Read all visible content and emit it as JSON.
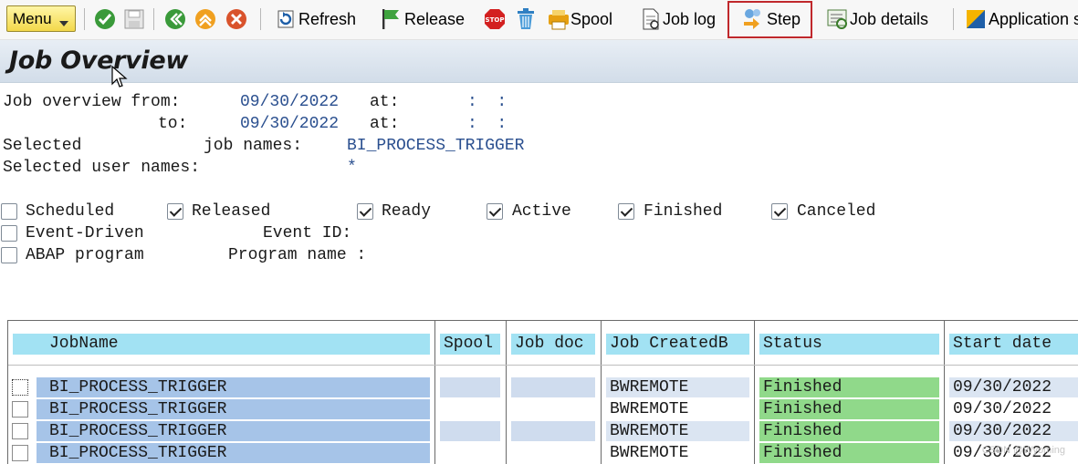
{
  "toolbar": {
    "menu_label": "Menu",
    "refresh_label": "Refresh",
    "release_label": "Release",
    "spool_label": "Spool",
    "job_log_label": "Job log",
    "step_label": "Step",
    "job_details_label": "Job details",
    "application_label": "Application s",
    "stop_icon_text": "STOP"
  },
  "title": "Job Overview",
  "criteria": {
    "from_label": "Job overview from:",
    "from_date": "09/30/2022",
    "to_label": "to:",
    "to_date": "09/30/2022",
    "at_label": "at:",
    "from_time": ":  :",
    "to_time": ":  :",
    "selected_label": "Selected",
    "job_names_label": "job names:",
    "job_names_value": "BI_PROCESS_TRIGGER",
    "user_names_label": "Selected user names:",
    "user_names_value": "*",
    "status_filters": [
      {
        "label": "Scheduled",
        "checked": false
      },
      {
        "label": "Released",
        "checked": true
      },
      {
        "label": "Ready",
        "checked": true
      },
      {
        "label": "Active",
        "checked": true
      },
      {
        "label": "Finished",
        "checked": true
      },
      {
        "label": "Canceled",
        "checked": true
      }
    ],
    "event_driven_label": "Event-Driven",
    "event_id_label": "Event ID:",
    "abap_program_label": "ABAP program",
    "program_name_label": "Program name :"
  },
  "table": {
    "columns": [
      "JobName",
      "Spool",
      "Job doc",
      "Job CreatedB",
      "Status",
      "Start date"
    ],
    "rows": [
      {
        "job_name": "BI_PROCESS_TRIGGER",
        "spool": "",
        "job_doc": "",
        "created_by": "BWREMOTE",
        "status": "Finished",
        "start_date": "09/30/2022"
      },
      {
        "job_name": "BI_PROCESS_TRIGGER",
        "spool": "",
        "job_doc": "",
        "created_by": "BWREMOTE",
        "status": "Finished",
        "start_date": "09/30/2022"
      },
      {
        "job_name": "BI_PROCESS_TRIGGER",
        "spool": "",
        "job_doc": "",
        "created_by": "BWREMOTE",
        "status": "Finished",
        "start_date": "09/30/2022"
      },
      {
        "job_name": "BI_PROCESS_TRIGGER",
        "spool": "",
        "job_doc": "",
        "created_by": "BWREMOTE",
        "status": "Finished",
        "start_date": "09/30/2022"
      }
    ]
  },
  "colors": {
    "jobname_cell": "#a6c4e8",
    "status_finished": "#90d98a",
    "header_bg": "#a2e2f3",
    "value_text": "#2a4f8f",
    "highlight_border": "#c0282c"
  },
  "watermark": "CSDN @Wyoming"
}
